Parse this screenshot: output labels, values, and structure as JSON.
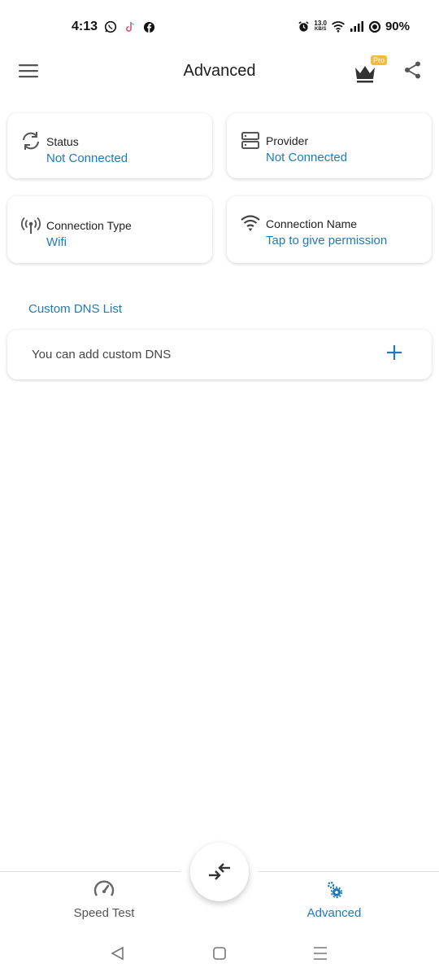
{
  "status_bar": {
    "time": "4:13",
    "net_speed_value": "13.0",
    "net_speed_unit": "KB/S",
    "battery": "90%"
  },
  "header": {
    "title": "Advanced",
    "pro_badge": "Pro"
  },
  "info_cards": [
    {
      "label": "Status",
      "value": "Not Connected",
      "icon": "refresh-icon"
    },
    {
      "label": "Provider",
      "value": "Not Connected",
      "icon": "server-icon"
    },
    {
      "label": "Connection Type",
      "value": "Wifi",
      "icon": "antenna-icon"
    },
    {
      "label": "Connection Name",
      "value": "Tap to give permission",
      "icon": "wifi-icon"
    }
  ],
  "custom_dns": {
    "title": "Custom DNS List",
    "placeholder": "You can add custom DNS"
  },
  "bottom_nav": {
    "speed_test": "Speed Test",
    "advanced": "Advanced"
  },
  "colors": {
    "accent": "#1e7ab8",
    "pro_badge": "#f6b93b",
    "text_dark": "#1f1f1f"
  }
}
